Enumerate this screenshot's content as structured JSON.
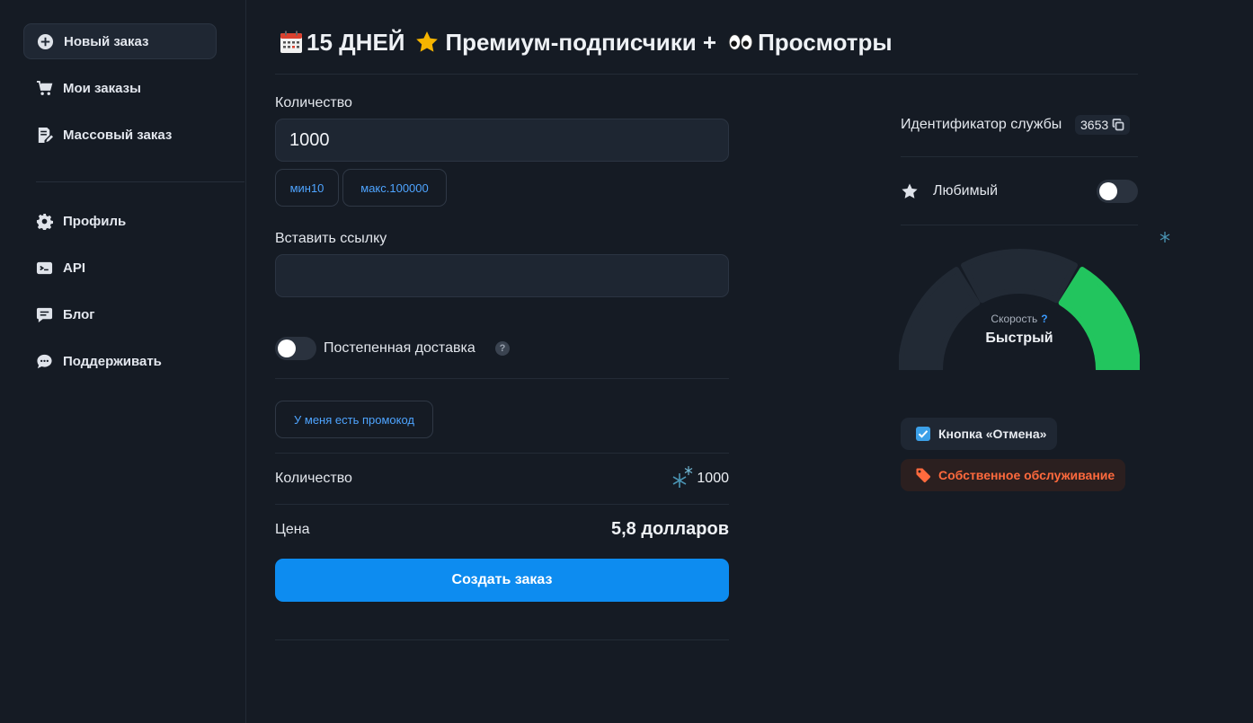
{
  "sidebar": {
    "items": [
      {
        "label": "Новый заказ",
        "icon": "plus-circle-icon",
        "active": true
      },
      {
        "label": "Мои заказы",
        "icon": "cart-icon"
      },
      {
        "label": "Массовый заказ",
        "icon": "document-edit-icon"
      },
      {
        "label": "Профиль",
        "icon": "gear-icon"
      },
      {
        "label": "API",
        "icon": "terminal-icon"
      },
      {
        "label": "Блог",
        "icon": "chat-icon"
      },
      {
        "label": "Поддерживать",
        "icon": "chat-bubble-icon"
      }
    ]
  },
  "header": {
    "title_part1": "15 ДНЕЙ",
    "title_part2": "Премиум-подписчики +",
    "title_part3": "Просмотры",
    "icons": [
      "calendar-icon",
      "star-icon",
      "eyes-icon"
    ]
  },
  "form": {
    "quantity_label": "Количество",
    "quantity_value": "1000",
    "min_chip": "мин10",
    "max_chip": "макс.100000",
    "link_label": "Вставить ссылку",
    "link_value": "",
    "gradual_label": "Постепенная доставка",
    "gradual_enabled": false,
    "help_mark": "?",
    "promo_button": "У меня есть промокод",
    "summary_quantity_label": "Количество",
    "summary_quantity_value": "1000",
    "price_label": "Цена",
    "price_value": "5,8 долларов",
    "submit_button": "Создать заказ"
  },
  "details": {
    "service_id_label": "Идентификатор службы",
    "service_id_value": "3653",
    "favorite_label": "Любимый",
    "favorite_enabled": false,
    "speed_label": "Скорость",
    "speed_help": "?",
    "speed_value": "Быстрый",
    "speed_level_segment": 3,
    "speed_segments_total": 3,
    "cancel_tag": "Кнопка «Отмена»",
    "own_service_tag": "Собственное обслуживание"
  },
  "colors": {
    "accent": "#0d8cf0",
    "link": "#4ea4ff",
    "gauge_active": "#22c55e",
    "warning": "#ff6a3d",
    "background": "#151b24"
  }
}
